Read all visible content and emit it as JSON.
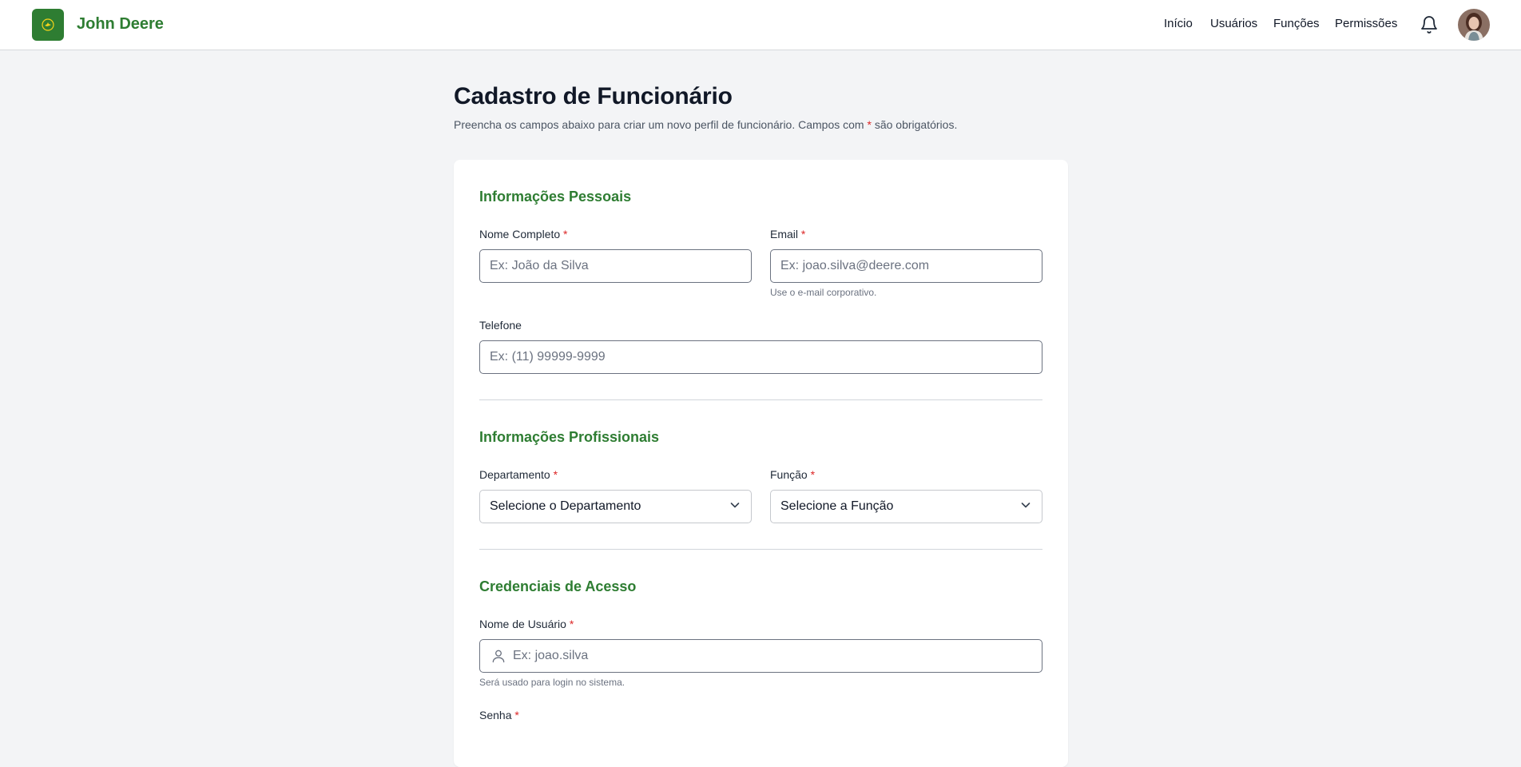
{
  "header": {
    "brand": "John Deere",
    "nav": [
      "Início",
      "Usuários",
      "Funções",
      "Permissões"
    ],
    "icons": {
      "logo": "deer-logo-icon",
      "notifications": "bell-icon",
      "avatar": "user-avatar"
    }
  },
  "page": {
    "title": "Cadastro de Funcionário",
    "subtitle_before": "Preencha os campos abaixo para criar um novo perfil de funcionário. Campos com ",
    "required_mark": "*",
    "subtitle_after": " são obrigatórios."
  },
  "sections": {
    "personal": {
      "title": "Informações Pessoais",
      "name_label": "Nome Completo",
      "name_placeholder": "Ex: João da Silva",
      "email_label": "Email",
      "email_placeholder": "Ex: joao.silva@deere.com",
      "email_hint": "Use o e-mail corporativo.",
      "phone_label": "Telefone",
      "phone_placeholder": "Ex: (11) 99999-9999"
    },
    "professional": {
      "title": "Informações Profissionais",
      "department_label": "Departamento",
      "department_value": "Selecione o Departamento",
      "role_label": "Função",
      "role_value": "Selecione a Função"
    },
    "credentials": {
      "title": "Credenciais de Acesso",
      "username_label": "Nome de Usuário",
      "username_placeholder": "Ex: joao.silva",
      "username_hint": "Será usado para login no sistema.",
      "password_label": "Senha"
    }
  },
  "colors": {
    "brand_green": "#2e7d32",
    "required_red": "#dc2626",
    "background": "#f3f4f6"
  }
}
